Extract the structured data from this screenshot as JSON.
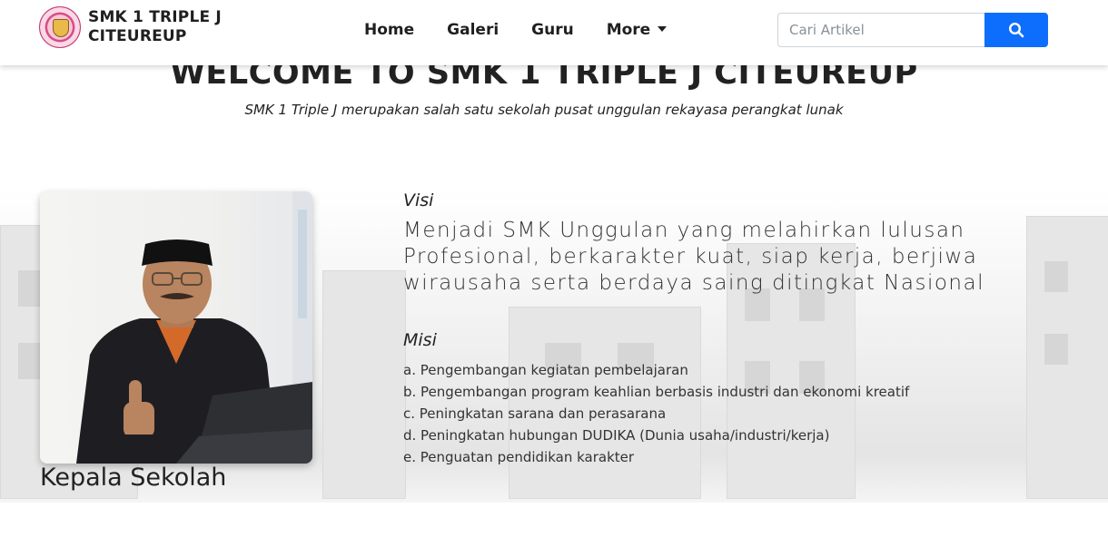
{
  "brand": {
    "line1": "SMK 1 TRIPLE J",
    "line2": "CITEUREUP"
  },
  "nav": {
    "items": [
      {
        "label": "Home"
      },
      {
        "label": "Galeri"
      },
      {
        "label": "Guru"
      },
      {
        "label": "More"
      }
    ]
  },
  "search": {
    "placeholder": "Cari Artikel",
    "button_icon": "search-icon"
  },
  "hero": {
    "title": "WELCOME TO SMK 1 TRIPLE J CITEUREUP",
    "subtitle": "SMK 1 Triple J merupakan salah satu sekolah pusat unggulan rekayasa perangkat lunak"
  },
  "principal": {
    "caption": "Kepala Sekolah"
  },
  "visi": {
    "label": "Visi",
    "text": "Menjadi SMK Unggulan yang melahirkan lulusan Profesional, berkarakter kuat, siap kerja, berjiwa wirausaha serta berdaya saing ditingkat Nasional"
  },
  "misi": {
    "label": "Misi",
    "items": [
      "a. Pengembangan kegiatan pembelajaran",
      "b. Pengembangan program keahlian berbasis industri dan ekonomi kreatif",
      "c. Peningkatan sarana dan perasarana",
      "d. Peningkatan hubungan DUDIKA (Dunia usaha/industri/kerja)",
      "e. Penguatan pendidikan karakter"
    ]
  },
  "colors": {
    "accent": "#0d6efd",
    "text": "#222222"
  }
}
